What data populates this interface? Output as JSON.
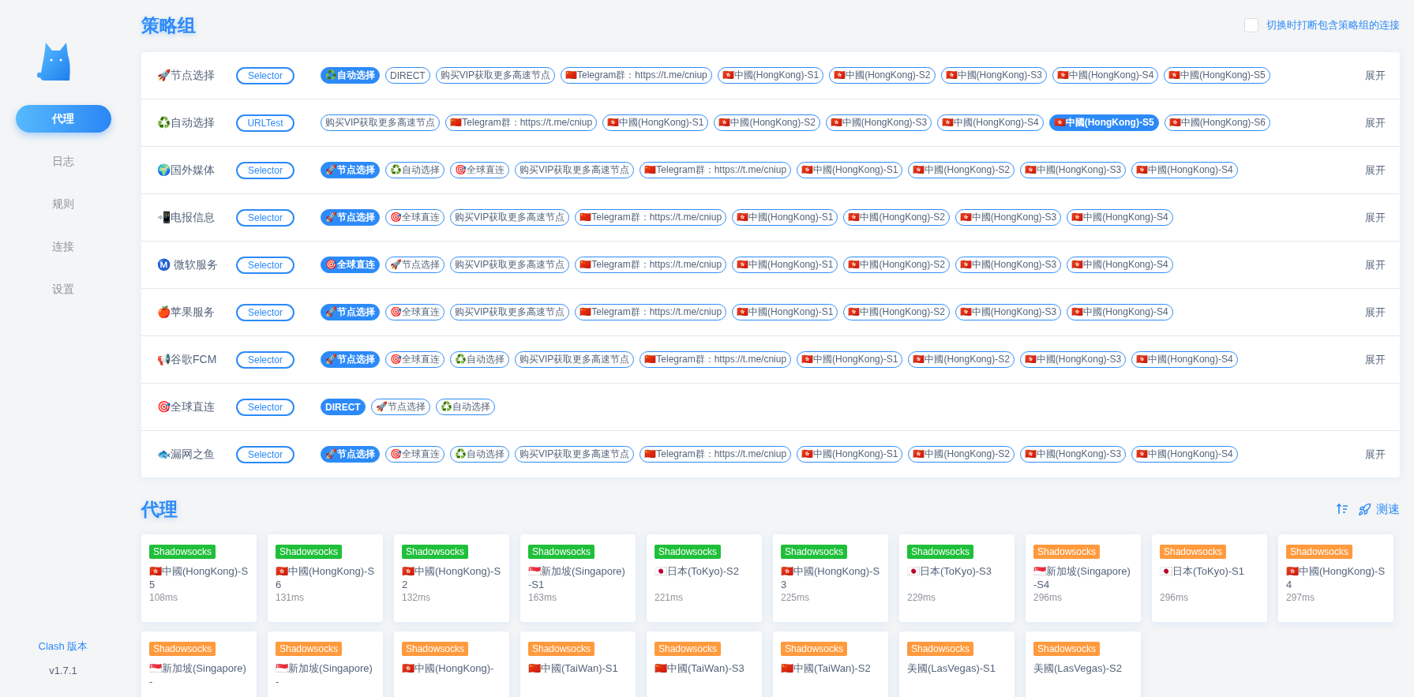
{
  "sidebar": {
    "items": [
      {
        "label": "代理",
        "selected": true
      },
      {
        "label": "日志",
        "selected": false
      },
      {
        "label": "规则",
        "selected": false
      },
      {
        "label": "连接",
        "selected": false
      },
      {
        "label": "设置",
        "selected": false
      }
    ],
    "version_label": "Clash 版本",
    "version": "v1.7.1"
  },
  "groups_section": {
    "title": "策略组",
    "option": {
      "label": "切换时打断包含策略组的连接",
      "checked": false
    },
    "groups": [
      {
        "name": "🚀节点选择",
        "type": "Selector",
        "expand": "展开",
        "proxies": [
          {
            "label": "♻️自动选择",
            "selected": true
          },
          {
            "label": "DIRECT",
            "selected": false
          },
          {
            "label": "购买VIP获取更多高速节点",
            "selected": false
          },
          {
            "label": "🇨🇳Telegram群：https://t.me/cniup",
            "selected": false
          },
          {
            "label": "🇭🇰中國(HongKong)-S1",
            "selected": false
          },
          {
            "label": "🇭🇰中國(HongKong)-S2",
            "selected": false
          },
          {
            "label": "🇭🇰中國(HongKong)-S3",
            "selected": false
          },
          {
            "label": "🇭🇰中國(HongKong)-S4",
            "selected": false
          },
          {
            "label": "🇭🇰中國(HongKong)-S5",
            "selected": false
          }
        ]
      },
      {
        "name": "♻️自动选择",
        "type": "URLTest",
        "expand": "展开",
        "proxies": [
          {
            "label": "购买VIP获取更多高速节点",
            "selected": false
          },
          {
            "label": "🇨🇳Telegram群：https://t.me/cniup",
            "selected": false
          },
          {
            "label": "🇭🇰中國(HongKong)-S1",
            "selected": false
          },
          {
            "label": "🇭🇰中國(HongKong)-S2",
            "selected": false
          },
          {
            "label": "🇭🇰中國(HongKong)-S3",
            "selected": false
          },
          {
            "label": "🇭🇰中國(HongKong)-S4",
            "selected": false
          },
          {
            "label": "🇭🇰中國(HongKong)-S5",
            "selected": true
          },
          {
            "label": "🇭🇰中國(HongKong)-S6",
            "selected": false
          }
        ]
      },
      {
        "name": "🌍国外媒体",
        "type": "Selector",
        "expand": "展开",
        "proxies": [
          {
            "label": "🚀节点选择",
            "selected": true
          },
          {
            "label": "♻️自动选择",
            "selected": false
          },
          {
            "label": "🎯全球直连",
            "selected": false
          },
          {
            "label": "购买VIP获取更多高速节点",
            "selected": false
          },
          {
            "label": "🇨🇳Telegram群：https://t.me/cniup",
            "selected": false
          },
          {
            "label": "🇭🇰中國(HongKong)-S1",
            "selected": false
          },
          {
            "label": "🇭🇰中國(HongKong)-S2",
            "selected": false
          },
          {
            "label": "🇭🇰中國(HongKong)-S3",
            "selected": false
          },
          {
            "label": "🇭🇰中國(HongKong)-S4",
            "selected": false
          }
        ]
      },
      {
        "name": "📲电报信息",
        "type": "Selector",
        "expand": "展开",
        "proxies": [
          {
            "label": "🚀节点选择",
            "selected": true
          },
          {
            "label": "🎯全球直连",
            "selected": false
          },
          {
            "label": "购买VIP获取更多高速节点",
            "selected": false
          },
          {
            "label": "🇨🇳Telegram群：https://t.me/cniup",
            "selected": false
          },
          {
            "label": "🇭🇰中國(HongKong)-S1",
            "selected": false
          },
          {
            "label": "🇭🇰中國(HongKong)-S2",
            "selected": false
          },
          {
            "label": "🇭🇰中國(HongKong)-S3",
            "selected": false
          },
          {
            "label": "🇭🇰中國(HongKong)-S4",
            "selected": false
          }
        ]
      },
      {
        "name": "Ⓜ️ 微软服务",
        "type": "Selector",
        "expand": "展开",
        "proxies": [
          {
            "label": "🎯全球直连",
            "selected": true
          },
          {
            "label": "🚀节点选择",
            "selected": false
          },
          {
            "label": "购买VIP获取更多高速节点",
            "selected": false
          },
          {
            "label": "🇨🇳Telegram群：https://t.me/cniup",
            "selected": false
          },
          {
            "label": "🇭🇰中國(HongKong)-S1",
            "selected": false
          },
          {
            "label": "🇭🇰中國(HongKong)-S2",
            "selected": false
          },
          {
            "label": "🇭🇰中國(HongKong)-S3",
            "selected": false
          },
          {
            "label": "🇭🇰中國(HongKong)-S4",
            "selected": false
          }
        ]
      },
      {
        "name": "🍎苹果服务",
        "type": "Selector",
        "expand": "展开",
        "proxies": [
          {
            "label": "🚀节点选择",
            "selected": true
          },
          {
            "label": "🎯全球直连",
            "selected": false
          },
          {
            "label": "购买VIP获取更多高速节点",
            "selected": false
          },
          {
            "label": "🇨🇳Telegram群：https://t.me/cniup",
            "selected": false
          },
          {
            "label": "🇭🇰中國(HongKong)-S1",
            "selected": false
          },
          {
            "label": "🇭🇰中國(HongKong)-S2",
            "selected": false
          },
          {
            "label": "🇭🇰中國(HongKong)-S3",
            "selected": false
          },
          {
            "label": "🇭🇰中國(HongKong)-S4",
            "selected": false
          }
        ]
      },
      {
        "name": "📢谷歌FCM",
        "type": "Selector",
        "expand": "展开",
        "proxies": [
          {
            "label": "🚀节点选择",
            "selected": true
          },
          {
            "label": "🎯全球直连",
            "selected": false
          },
          {
            "label": "♻️自动选择",
            "selected": false
          },
          {
            "label": "购买VIP获取更多高速节点",
            "selected": false
          },
          {
            "label": "🇨🇳Telegram群：https://t.me/cniup",
            "selected": false
          },
          {
            "label": "🇭🇰中國(HongKong)-S1",
            "selected": false
          },
          {
            "label": "🇭🇰中國(HongKong)-S2",
            "selected": false
          },
          {
            "label": "🇭🇰中國(HongKong)-S3",
            "selected": false
          },
          {
            "label": "🇭🇰中國(HongKong)-S4",
            "selected": false
          }
        ]
      },
      {
        "name": "🎯全球直连",
        "type": "Selector",
        "proxies": [
          {
            "label": "DIRECT",
            "selected": true
          },
          {
            "label": "🚀节点选择",
            "selected": false
          },
          {
            "label": "♻️自动选择",
            "selected": false
          }
        ]
      },
      {
        "name": "🐟漏网之鱼",
        "type": "Selector",
        "expand": "展开",
        "proxies": [
          {
            "label": "🚀节点选择",
            "selected": true
          },
          {
            "label": "🎯全球直连",
            "selected": false
          },
          {
            "label": "♻️自动选择",
            "selected": false
          },
          {
            "label": "购买VIP获取更多高速节点",
            "selected": false
          },
          {
            "label": "🇨🇳Telegram群：https://t.me/cniup",
            "selected": false
          },
          {
            "label": "🇭🇰中國(HongKong)-S1",
            "selected": false
          },
          {
            "label": "🇭🇰中國(HongKong)-S2",
            "selected": false
          },
          {
            "label": "🇭🇰中國(HongKong)-S3",
            "selected": false
          },
          {
            "label": "🇭🇰中國(HongKong)-S4",
            "selected": false
          }
        ]
      }
    ]
  },
  "proxies_section": {
    "title": "代理",
    "test_button": "测速",
    "cards": [
      {
        "protocol": "Shadowsocks",
        "color": "#1fbf3a",
        "name": "🇭🇰中國(HongKong)-S5",
        "latency": "108ms"
      },
      {
        "protocol": "Shadowsocks",
        "color": "#1fbf3a",
        "name": "🇭🇰中國(HongKong)-S6",
        "latency": "131ms"
      },
      {
        "protocol": "Shadowsocks",
        "color": "#1fbf3a",
        "name": "🇭🇰中國(HongKong)-S2",
        "latency": "132ms"
      },
      {
        "protocol": "Shadowsocks",
        "color": "#1fbf3a",
        "name": "🇸🇬新加坡(Singapore)-S1",
        "latency": "163ms"
      },
      {
        "protocol": "Shadowsocks",
        "color": "#1fbf3a",
        "name": "🇯🇵日本(ToKyo)-S2",
        "latency": "221ms"
      },
      {
        "protocol": "Shadowsocks",
        "color": "#1fbf3a",
        "name": "🇭🇰中國(HongKong)-S3",
        "latency": "225ms"
      },
      {
        "protocol": "Shadowsocks",
        "color": "#1fbf3a",
        "name": "🇯🇵日本(ToKyo)-S3",
        "latency": "229ms"
      },
      {
        "protocol": "Shadowsocks",
        "color": "#ff9a3d",
        "name": "🇸🇬新加坡(Singapore)-S4",
        "latency": "296ms"
      },
      {
        "protocol": "Shadowsocks",
        "color": "#ff9a3d",
        "name": "🇯🇵日本(ToKyo)-S1",
        "latency": "296ms"
      },
      {
        "protocol": "Shadowsocks",
        "color": "#ff9a3d",
        "name": "🇭🇰中國(HongKong)-S4",
        "latency": "297ms"
      },
      {
        "protocol": "Shadowsocks",
        "color": "#ff9a3d",
        "name": "🇸🇬新加坡(Singapore)-"
      },
      {
        "protocol": "Shadowsocks",
        "color": "#ff9a3d",
        "name": "🇸🇬新加坡(Singapore)-"
      },
      {
        "protocol": "Shadowsocks",
        "color": "#ff9a3d",
        "name": "🇭🇰中國(HongKong)-"
      },
      {
        "protocol": "Shadowsocks",
        "color": "#ff9a3d",
        "name": "🇨🇳中國(TaiWan)-S1"
      },
      {
        "protocol": "Shadowsocks",
        "color": "#ff9a3d",
        "name": "🇨🇳中國(TaiWan)-S3"
      },
      {
        "protocol": "Shadowsocks",
        "color": "#ff9a3d",
        "name": "🇨🇳中國(TaiWan)-S2"
      },
      {
        "protocol": "Shadowsocks",
        "color": "#ff9a3d",
        "name": "美國(LasVegas)-S1"
      },
      {
        "protocol": "Shadowsocks",
        "color": "#ff9a3d",
        "name": "美國(LasVegas)-S2"
      }
    ]
  }
}
